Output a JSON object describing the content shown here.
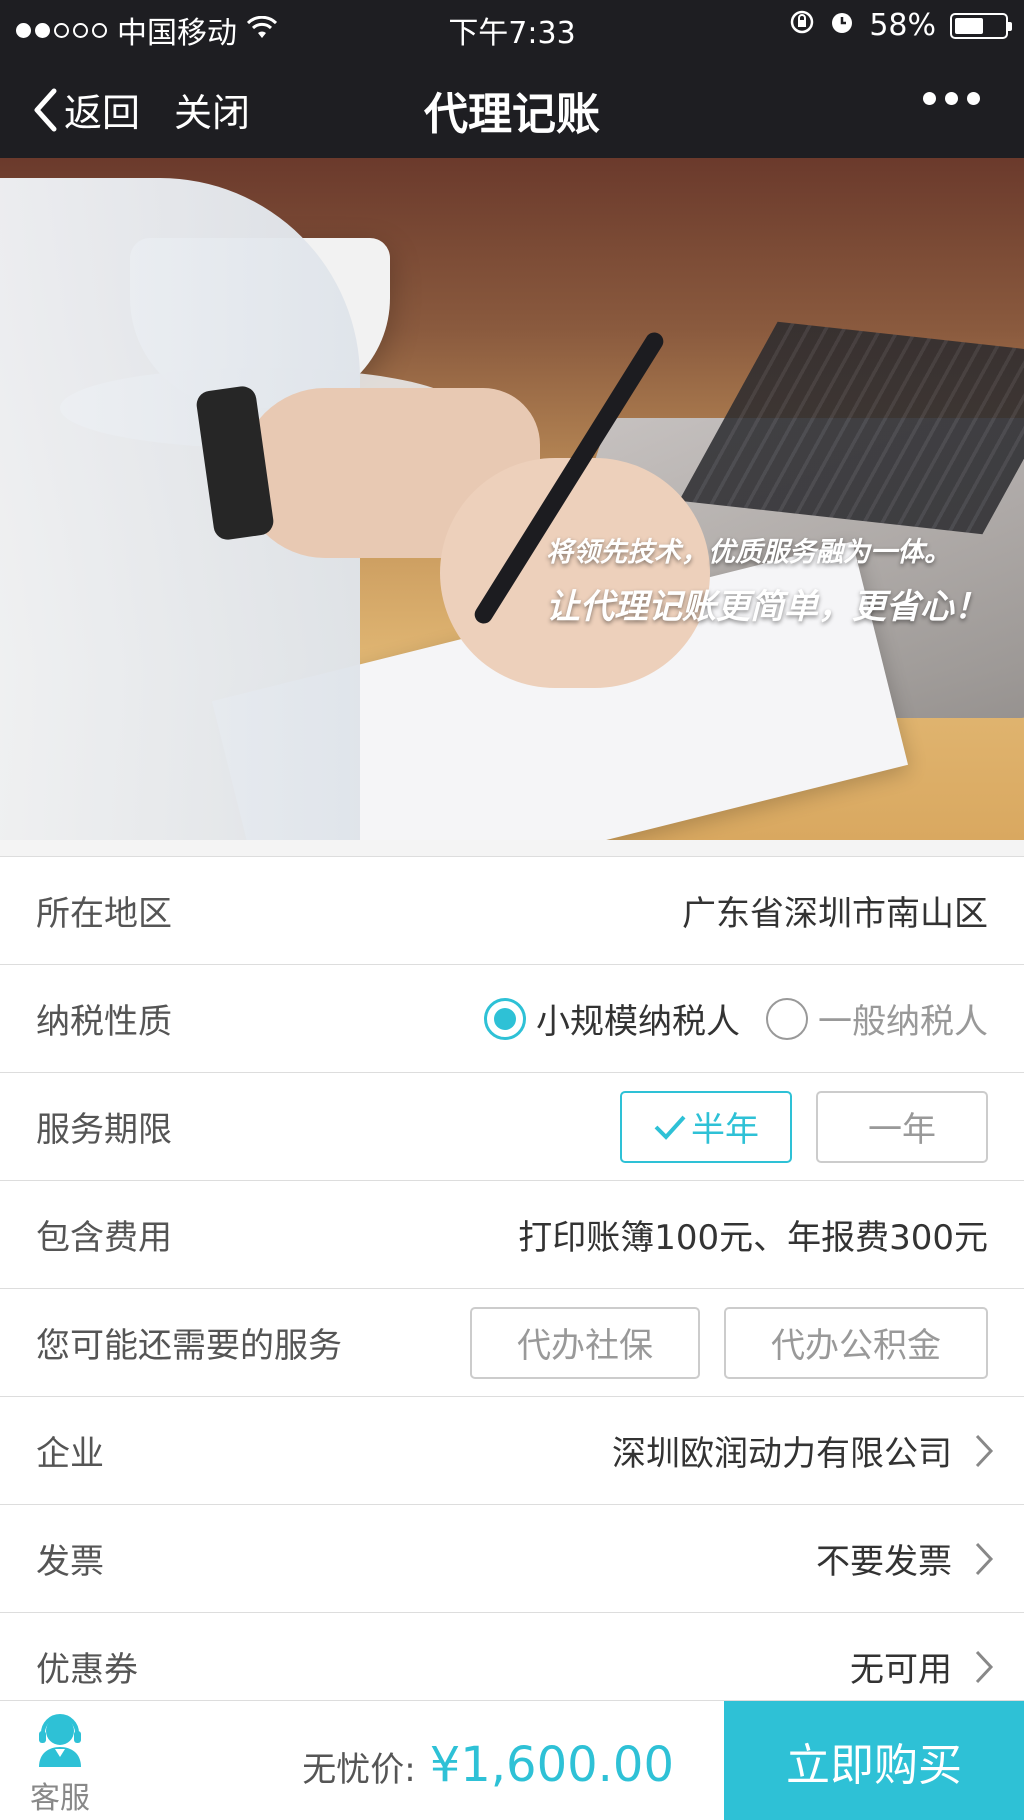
{
  "status_bar": {
    "carrier": "中国移动",
    "time": "下午7:33",
    "battery_text": "58%",
    "battery_level": 0.58,
    "icons": [
      "signal-dots-icon",
      "wifi-icon",
      "rotation-lock-icon",
      "alarm-icon",
      "battery-icon"
    ]
  },
  "nav": {
    "back_label": "返回",
    "close_label": "关闭",
    "title": "代理记账"
  },
  "banner": {
    "line1": "将领先技术，优质服务融为一体。",
    "line2": "让代理记账更简单，更省心！"
  },
  "rows": {
    "region": {
      "label": "所在地区",
      "value": "广东省深圳市南山区"
    },
    "tax_type": {
      "label": "纳税性质",
      "options": [
        {
          "label": "小规模纳税人",
          "selected": true
        },
        {
          "label": "一般纳税人",
          "selected": false
        }
      ]
    },
    "period": {
      "label": "服务期限",
      "options": [
        {
          "label": "半年",
          "selected": true
        },
        {
          "label": "一年",
          "selected": false
        }
      ]
    },
    "fees": {
      "label": "包含费用",
      "value": "打印账簿100元、年报费300元"
    },
    "extra": {
      "label": "您可能还需要的服务",
      "options": [
        {
          "label": "代办社保"
        },
        {
          "label": "代办公积金"
        }
      ]
    },
    "company": {
      "label": "企业",
      "value": "深圳欧润动力有限公司"
    },
    "invoice": {
      "label": "发票",
      "value": "不要发票"
    },
    "coupon": {
      "label": "优惠券",
      "value": "无可用"
    }
  },
  "bottom": {
    "service_label": "客服",
    "price_label": "无忧价:",
    "price_value": "¥1,600.00",
    "buy_label": "立即购买"
  },
  "colors": {
    "accent": "#2ec1d6",
    "topbar": "#1e1e22"
  }
}
